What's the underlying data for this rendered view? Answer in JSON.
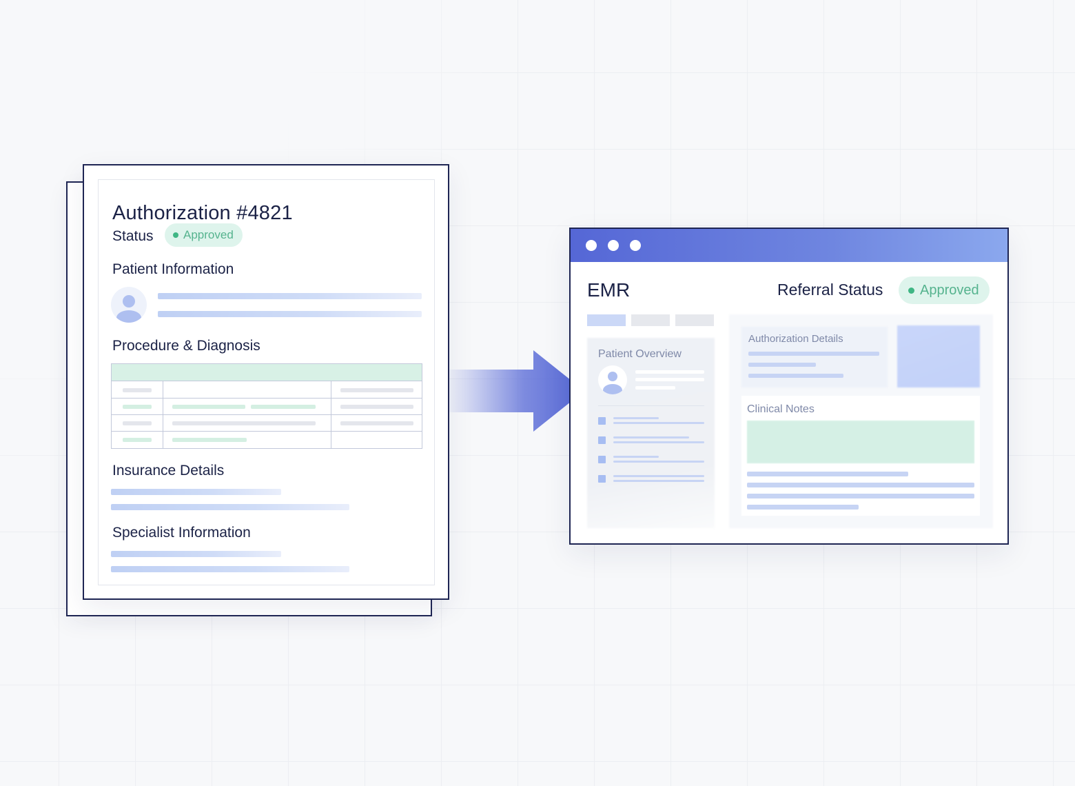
{
  "document": {
    "title": "Authorization #4821",
    "status_label": "Status",
    "status_value": "Approved",
    "sections": {
      "patient": "Patient Information",
      "procedure": "Procedure & Diagnosis",
      "insurance": "Insurance Details",
      "specialist": "Specialist Information"
    }
  },
  "emr": {
    "title": "EMR",
    "referral_label": "Referral Status",
    "referral_value": "Approved",
    "panels": {
      "patient_overview": "Patient Overview",
      "authorization_details": "Authorization Details",
      "clinical_notes": "Clinical Notes"
    }
  },
  "icons": [
    "avatar-icon",
    "arrow-right-icon",
    "status-dot-icon",
    "window-control-icon"
  ],
  "colors": {
    "navy": "#1e2553",
    "approved_bg": "#def4ec",
    "approved_text": "#55b38e",
    "accent_blue": "#5567d6"
  }
}
